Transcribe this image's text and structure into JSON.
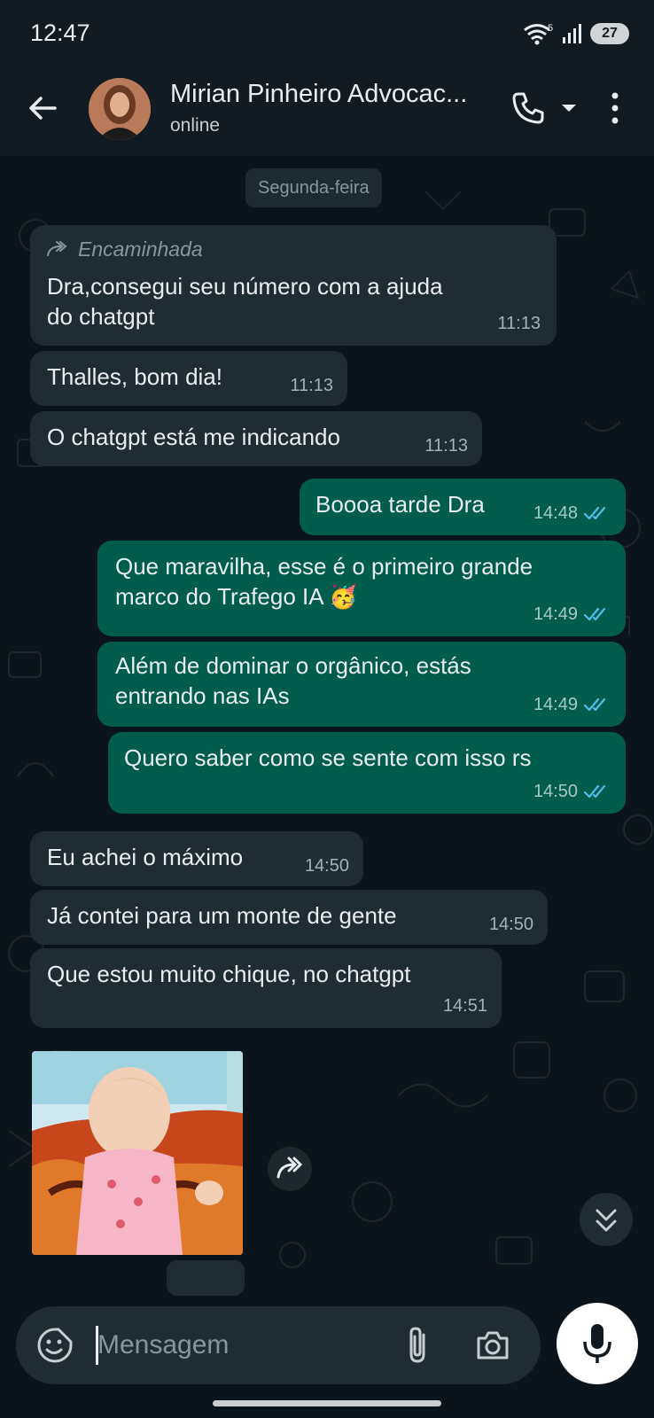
{
  "status_bar": {
    "time": "12:47",
    "battery": "27"
  },
  "header": {
    "name": "Mirian Pinheiro Advocac...",
    "status": "online"
  },
  "chat": {
    "date_chip": "Segunda-feira",
    "messages": [
      {
        "dir": "in",
        "forwarded_label": "Encaminhada",
        "text_line1": "Dra,consegui seu número com a ajuda",
        "text_line2": "do chatgpt",
        "time": "11:13"
      },
      {
        "dir": "in",
        "text": "Thalles,  bom dia!",
        "time": "11:13"
      },
      {
        "dir": "in",
        "text": "O chatgpt está me indicando",
        "time": "11:13"
      },
      {
        "dir": "out",
        "text": "Boooa tarde Dra",
        "time": "14:48",
        "status": "read"
      },
      {
        "dir": "out",
        "text_line1": "Que maravilha, esse é o primeiro grande",
        "text_line2": "marco do Trafego IA 🥳",
        "time": "14:49",
        "status": "read"
      },
      {
        "dir": "out",
        "text_line1": "Além de dominar o orgânico, estás",
        "text_line2": "entrando nas IAs",
        "time": "14:49",
        "status": "read"
      },
      {
        "dir": "out",
        "text": "Quero saber como se sente com isso rs",
        "time": "14:50",
        "status": "read"
      },
      {
        "dir": "in",
        "text": "Eu achei o máximo",
        "time": "14:50"
      },
      {
        "dir": "in",
        "text": "Já contei para um monte de gente",
        "time": "14:50"
      },
      {
        "dir": "in",
        "text": "Que estou muito chique,  no chatgpt",
        "time": "14:51"
      }
    ],
    "photo_icon": "baby-photo"
  },
  "input": {
    "placeholder": "Mensagem"
  },
  "colors": {
    "background": "#0b141a",
    "incoming": "#202c33",
    "outgoing": "#005c4b",
    "read_tick": "#53bdeb"
  }
}
